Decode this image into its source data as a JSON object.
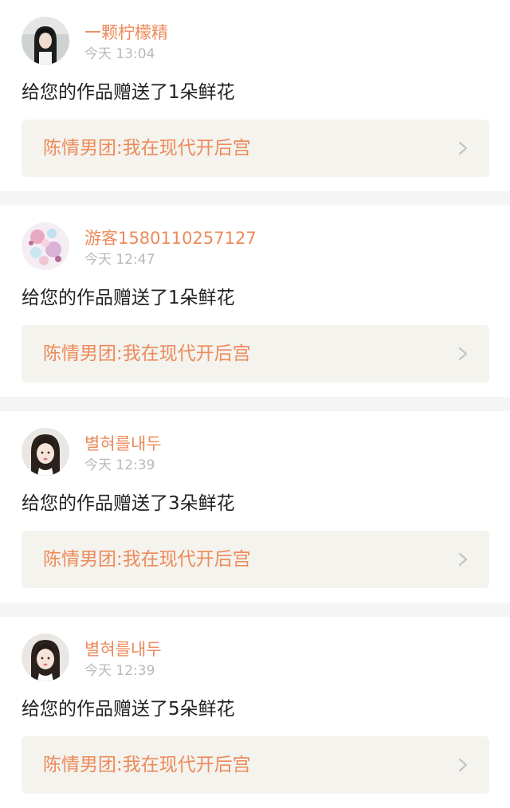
{
  "notifications": [
    {
      "user": "一颗柠檬精",
      "time": "今天 13:04",
      "message": "给您的作品赠送了1朵鲜花",
      "work_title": "陈情男团:我在现代开后宫",
      "avatar": "avatar-dark-hair"
    },
    {
      "user": "游客1580110257127",
      "time": "今天 12:47",
      "message": "给您的作品赠送了1朵鲜花",
      "work_title": "陈情男团:我在现代开后宫",
      "avatar": "avatar-pink-flowers"
    },
    {
      "user": "별혀를내두",
      "time": "今天 12:39",
      "message": "给您的作品赠送了3朵鲜花",
      "work_title": "陈情男团:我在现代开后宫",
      "avatar": "avatar-girl-portrait"
    },
    {
      "user": "별혀를내두",
      "time": "今天 12:39",
      "message": "给您的作品赠送了5朵鲜花",
      "work_title": "陈情男团:我在现代开后宫",
      "avatar": "avatar-girl-portrait"
    }
  ],
  "colors": {
    "accent": "#ed8a5a",
    "timestamp": "#b9b9b9",
    "text": "#222222",
    "work_card_bg": "#f4f3ee",
    "separator": "#f5f5f5",
    "chevron": "#c4c4c4"
  },
  "icons": {
    "work_arrow": "chevron-right-icon"
  }
}
